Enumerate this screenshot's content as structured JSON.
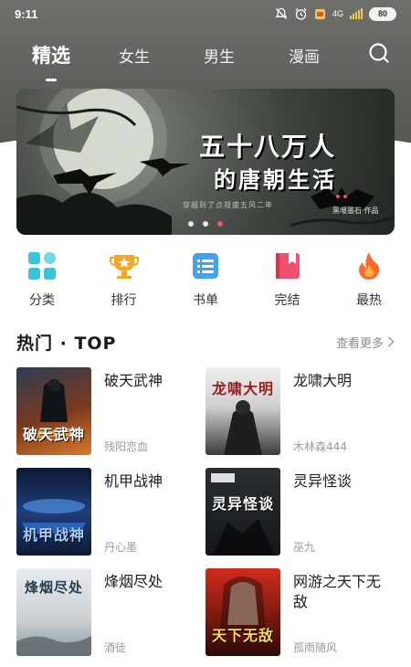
{
  "status_bar": {
    "time": "9:11",
    "network": "4G",
    "battery": "80"
  },
  "tabs": [
    {
      "label": "精选",
      "active": true
    },
    {
      "label": "女生",
      "active": false
    },
    {
      "label": "男生",
      "active": false
    },
    {
      "label": "漫画",
      "active": false
    }
  ],
  "banner": {
    "title_line1": "五十八万人",
    "title_line2": "的唐朝生活",
    "subtitle": "穿越到了贞观盛五风二年",
    "author": "黑暖墨石·作品",
    "page_count": 3,
    "active_page": 2
  },
  "categories": [
    {
      "label": "分类",
      "icon": "grid-icon"
    },
    {
      "label": "排行",
      "icon": "trophy-icon"
    },
    {
      "label": "书单",
      "icon": "list-icon"
    },
    {
      "label": "完结",
      "icon": "bookmark-book-icon"
    },
    {
      "label": "最热",
      "icon": "flame-icon"
    }
  ],
  "section": {
    "title": "热门 · TOP",
    "more_label": "查看更多"
  },
  "books": [
    {
      "title": "破天武神",
      "author": "残阳恋血",
      "cover_text": "破天武神"
    },
    {
      "title": "龙啸大明",
      "author": "木林森444",
      "cover_text": "龙啸大明"
    },
    {
      "title": "机甲战神",
      "author": "丹心墨",
      "cover_text": "机甲战神"
    },
    {
      "title": "灵异怪谈",
      "author": "巫九",
      "cover_text": "灵异怪谈"
    },
    {
      "title": "烽烟尽处",
      "author": "酒徒",
      "cover_text": "烽烟尽处"
    },
    {
      "title": "网游之天下无敌",
      "author": "孤雨随风",
      "cover_text": "天下无敌"
    }
  ],
  "colors": {
    "accent_dot": "#e8536b",
    "header_bg": "#5b5c57"
  }
}
